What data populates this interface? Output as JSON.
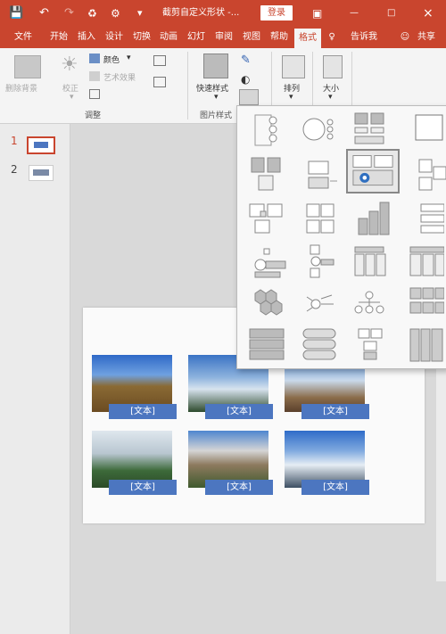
{
  "title_bar": {
    "doc_title": "截剪自定义形状 -...",
    "login_label": "登录",
    "win_min": "—",
    "win_max": "□",
    "win_close": "×"
  },
  "tabs": [
    {
      "label": "文件"
    },
    {
      "label": "开始"
    },
    {
      "label": "插入"
    },
    {
      "label": "设计"
    },
    {
      "label": "切换"
    },
    {
      "label": "动画"
    },
    {
      "label": "幻灯"
    },
    {
      "label": "审阅"
    },
    {
      "label": "视图"
    },
    {
      "label": "帮助"
    },
    {
      "label": "格式",
      "active": true
    },
    {
      "label": "告诉我"
    },
    {
      "label": "共享"
    }
  ],
  "ribbon": {
    "remove_bg": "删除背景",
    "correct": "校正",
    "color": "颜色",
    "artistic": "艺术效果",
    "adjust_group": "调整",
    "quick_styles": "快速样式",
    "picture_styles_group": "图片样式",
    "arrange": "排列",
    "size": "大小"
  },
  "slides_panel": {
    "slides": [
      {
        "number": "1"
      },
      {
        "number": "2"
      }
    ]
  },
  "slide": {
    "captions": [
      "[文本]",
      "[文本]",
      "[文本]",
      "[文本]",
      "[文本]",
      "[文本]"
    ]
  },
  "colors": {
    "accent": "#c9452e",
    "caption_fill": "#4c76c0"
  }
}
